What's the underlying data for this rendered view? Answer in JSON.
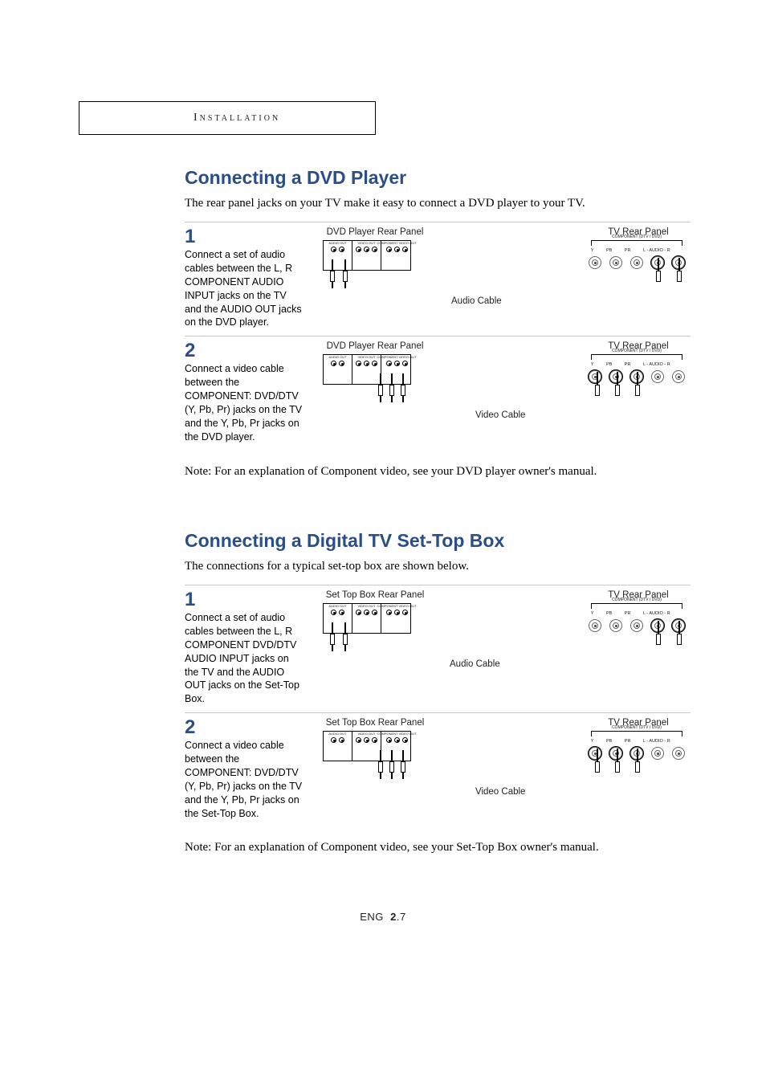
{
  "header": {
    "tab_label": "Installation"
  },
  "section_dvd": {
    "title": "Connecting a DVD Player",
    "intro": "The rear panel jacks on your TV make it easy to connect a DVD player to your TV.",
    "note": "Note: For an explanation of Component video, see your DVD player owner's manual.",
    "step1": {
      "num": "1",
      "desc": "Connect a set of audio cables between the L, R COMPONENT AUDIO INPUT jacks on the TV and the AUDIO OUT jacks on the DVD player.",
      "src_title": "DVD Player Rear Panel",
      "tv_title": "TV Rear Panel",
      "cable_label": "Audio Cable"
    },
    "step2": {
      "num": "2",
      "desc": "Connect a video cable between the COMPONENT: DVD/DTV (Y, Pb, Pr) jacks on the TV and the Y, Pb, Pr jacks on the DVD player.",
      "src_title": "DVD Player Rear Panel",
      "tv_title": "TV Rear Panel",
      "cable_label": "Video Cable"
    }
  },
  "section_stb": {
    "title": "Connecting a Digital TV Set-Top Box",
    "intro": "The connections for a typical set-top box are shown below.",
    "note": "Note: For an explanation of Component video, see your Set-Top Box owner's manual.",
    "step1": {
      "num": "1",
      "desc": "Connect a set of audio cables between the L, R COMPONENT DVD/DTV AUDIO INPUT jacks on the TV and the AUDIO OUT jacks on the Set-Top Box.",
      "src_title": "Set Top Box Rear Panel",
      "tv_title": "TV Rear Panel",
      "cable_label": "Audio Cable"
    },
    "step2": {
      "num": "2",
      "desc": "Connect a video cable between the COMPONENT: DVD/DTV (Y, Pb, Pr) jacks on the TV and the Y, Pb, Pr jacks on the Set-Top Box.",
      "src_title": "Set Top Box Rear Panel",
      "tv_title": "TV Rear Panel",
      "cable_label": "Video Cable"
    }
  },
  "diagram_common": {
    "src_groups": {
      "g1": "AUDIO OUT",
      "g2": "VIDEO OUT",
      "g3": "COMPONENT VIDEO OUT"
    },
    "tv_group_label": "COMPONENT (DTV / DVD)",
    "tv_jacks": [
      "Y",
      "PB",
      "PR",
      "L - AUDIO - R",
      ""
    ]
  },
  "tv_jack_labels": {
    "y": "Y",
    "pb": "PB",
    "pr": "PR",
    "audio": "L - AUDIO - R"
  },
  "footer": {
    "lang": "ENG",
    "chapter": "2",
    "page": ".7"
  }
}
